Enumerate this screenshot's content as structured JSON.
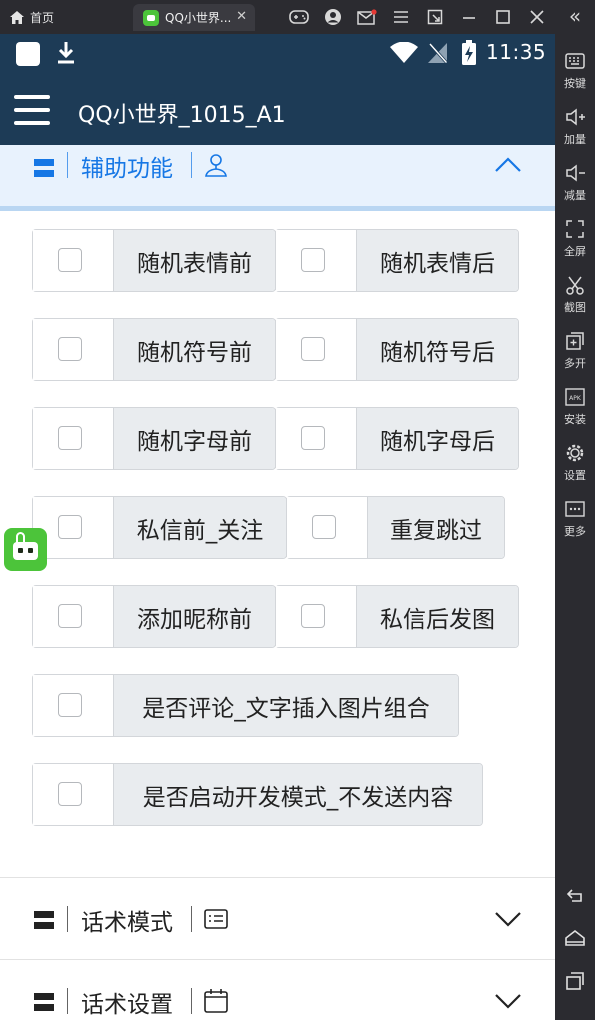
{
  "emulator": {
    "home_tab_label": "首页",
    "app_tab_title": "QQ小世界...",
    "app_tab_close": "✕",
    "collapse_label": "«",
    "toolbar": [
      {
        "label": "按键",
        "icon": "keyboard-icon"
      },
      {
        "label": "加量",
        "icon": "volume-up-icon"
      },
      {
        "label": "减量",
        "icon": "volume-down-icon"
      },
      {
        "label": "全屏",
        "icon": "fullscreen-icon"
      },
      {
        "label": "截图",
        "icon": "scissors-icon"
      },
      {
        "label": "多开",
        "icon": "multi-instance-icon"
      },
      {
        "label": "安装",
        "icon": "apk-icon"
      },
      {
        "label": "设置",
        "icon": "gear-icon"
      },
      {
        "label": "更多",
        "icon": "more-icon"
      }
    ],
    "nav": [
      "back-icon",
      "home-icon",
      "recents-icon"
    ]
  },
  "statusbar": {
    "time": "11:35"
  },
  "appbar": {
    "title": "QQ小世界_1015_A1"
  },
  "sections": {
    "assist": {
      "label": "辅助功能",
      "expanded": true
    },
    "script_mode": {
      "label": "话术模式",
      "expanded": false
    },
    "script_settings": {
      "label": "话术设置",
      "expanded": false
    }
  },
  "options": [
    {
      "label": "随机表情前",
      "checked": false
    },
    {
      "label": "随机表情后",
      "checked": false
    },
    {
      "label": "随机符号前",
      "checked": false
    },
    {
      "label": "随机符号后",
      "checked": false
    },
    {
      "label": "随机字母前",
      "checked": false
    },
    {
      "label": "随机字母后",
      "checked": false
    },
    {
      "label": "私信前_关注",
      "checked": false
    },
    {
      "label": "重复跳过",
      "checked": false
    },
    {
      "label": "添加昵称前",
      "checked": false
    },
    {
      "label": "私信后发图",
      "checked": false
    },
    {
      "label": "是否评论_文字插入图片组合",
      "checked": false
    },
    {
      "label": "是否启动开发模式_不发送内容",
      "checked": false
    }
  ],
  "colors": {
    "appbar": "#1d3b56",
    "accent": "#1677e5",
    "section_active_bg": "#e8f2fd",
    "checkbox_label_bg": "#e9ecef"
  }
}
